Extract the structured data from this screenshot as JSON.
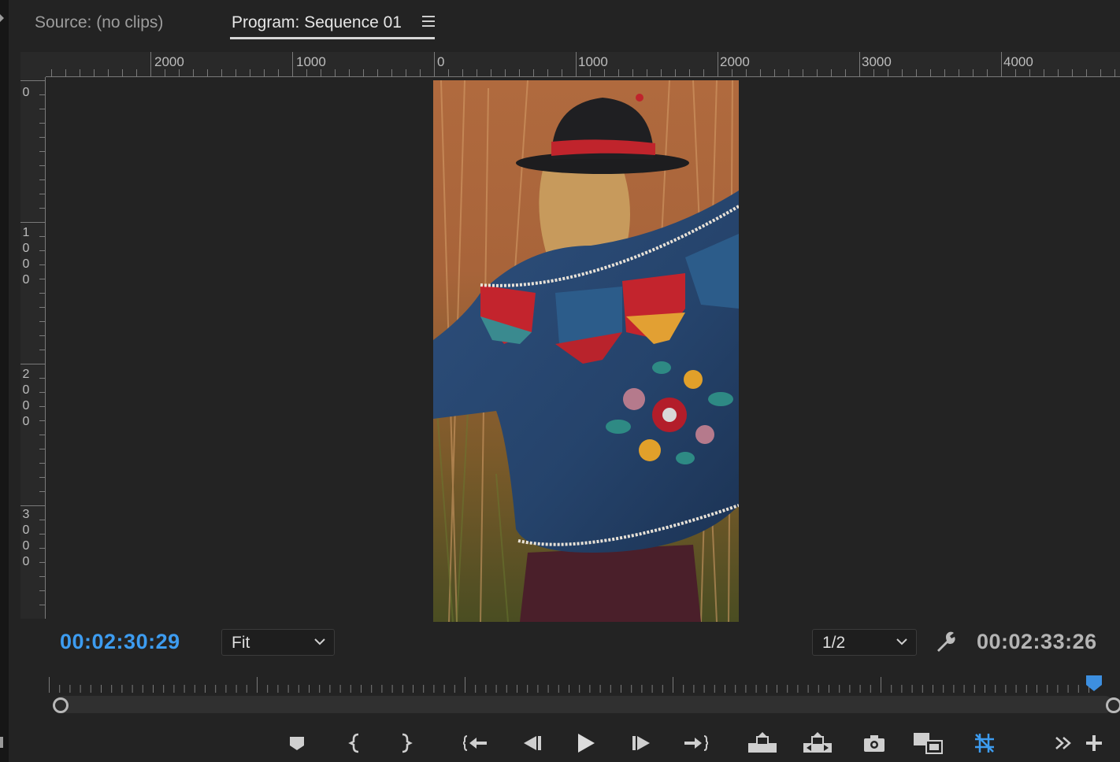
{
  "tabs": {
    "source_label": "Source: (no clips)",
    "program_label": "Program: Sequence 01"
  },
  "ruler": {
    "top_labels": [
      "2000",
      "1000",
      "0",
      "1000",
      "2000",
      "3000",
      "4000"
    ],
    "left_labels": [
      "0",
      "1000",
      "2000",
      "3000"
    ]
  },
  "monitor": {
    "current_timecode": "00:02:30:29",
    "duration_timecode": "00:02:33:26",
    "zoom_value": "Fit",
    "resolution_value": "1/2",
    "playhead_position_fraction": 0.985
  },
  "colors": {
    "accent_blue": "#3d9cf0",
    "panel_bg": "#232323",
    "ruler_bg": "#292929"
  },
  "transport": {
    "buttons": [
      "add-marker",
      "mark-in",
      "mark-out",
      "go-to-in",
      "step-back",
      "play",
      "step-forward",
      "go-to-out",
      "lift",
      "extract",
      "export-frame",
      "comparison-view",
      "toggle-proxies",
      "more-buttons",
      "button-editor"
    ]
  }
}
